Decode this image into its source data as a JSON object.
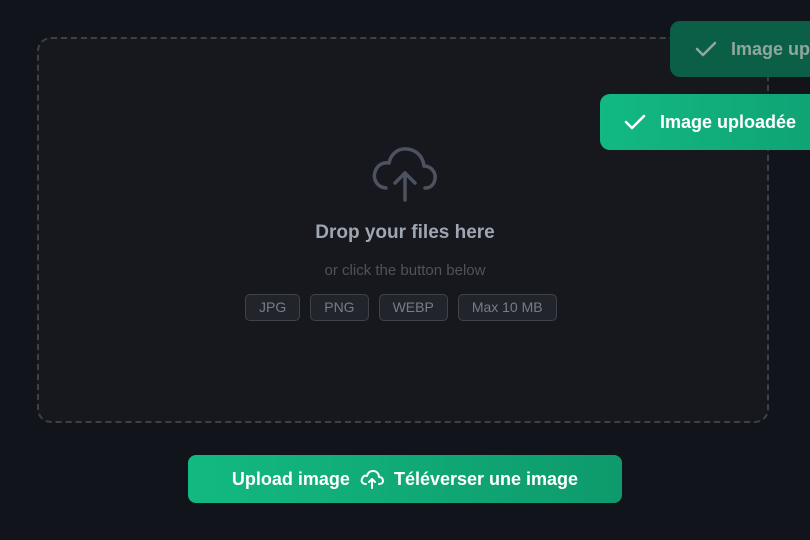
{
  "dropzone": {
    "title": "Drop your files here",
    "subtitle": "or click the button below",
    "formats": [
      "JPG",
      "PNG",
      "WEBP",
      "Max 10 MB"
    ],
    "icon": "cloud-upload-icon"
  },
  "upload_button": {
    "label_en": "Upload image",
    "label_fr": "Téléverser une image",
    "icon": "cloud-upload-icon"
  },
  "toasts": [
    {
      "text": "Image up",
      "icon": "check-icon"
    },
    {
      "text": "Image uploadée",
      "icon": "check-icon"
    }
  ],
  "colors": {
    "accent": "#13b981",
    "background": "#12141b",
    "dropzone": "#17181e"
  }
}
